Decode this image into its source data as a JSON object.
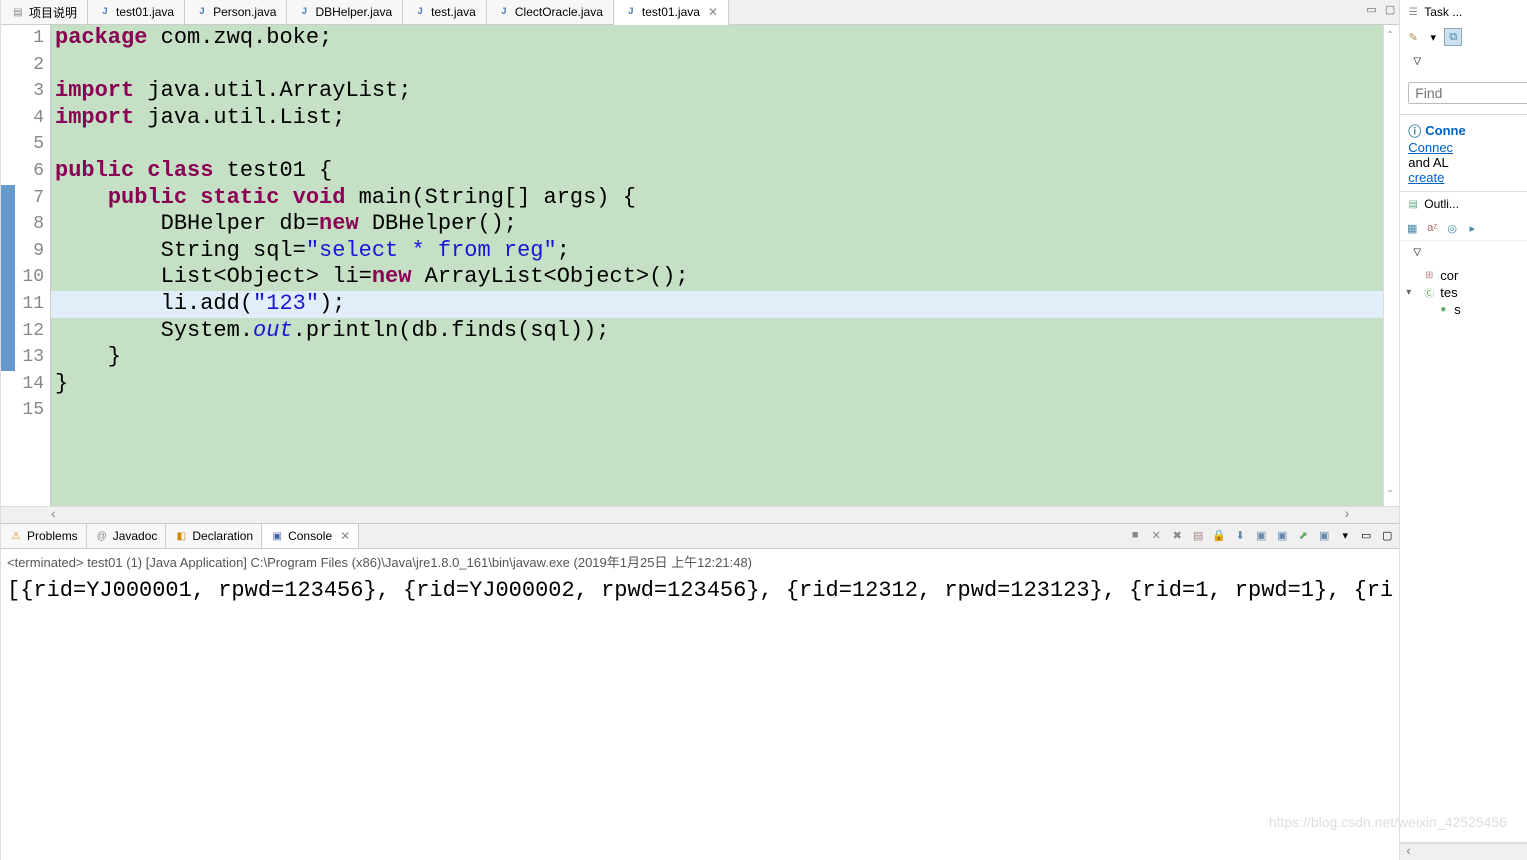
{
  "tabs": [
    {
      "label": "项目说明",
      "icon": "doc"
    },
    {
      "label": "test01.java",
      "icon": "java"
    },
    {
      "label": "Person.java",
      "icon": "java"
    },
    {
      "label": "DBHelper.java",
      "icon": "java"
    },
    {
      "label": "test.java",
      "icon": "java"
    },
    {
      "label": "ClectOracle.java",
      "icon": "java"
    },
    {
      "label": "test01.java",
      "icon": "java",
      "active": true,
      "closable": true
    }
  ],
  "code": {
    "lines": [
      {
        "n": 1,
        "html": "<span class='kw'>package</span> com.zwq.boke;"
      },
      {
        "n": 2,
        "html": ""
      },
      {
        "n": 3,
        "html": "<span class='kw'>import</span> java.util.ArrayList;"
      },
      {
        "n": 4,
        "html": "<span class='kw'>import</span> java.util.List;"
      },
      {
        "n": 5,
        "html": ""
      },
      {
        "n": 6,
        "html": "<span class='kw'>public</span> <span class='kw'>class</span> test01 {"
      },
      {
        "n": 7,
        "html": "    <span class='kw'>public</span> <span class='kw'>static</span> <span class='kw'>void</span> main(String[] args) {",
        "marker": true
      },
      {
        "n": 8,
        "html": "        DBHelper db=<span class='kw'>new</span> DBHelper();",
        "marker": true
      },
      {
        "n": 9,
        "html": "        String sql=<span class='str'>\"select * from reg\"</span>;",
        "marker": true
      },
      {
        "n": 10,
        "html": "        List&lt;Object&gt; li=<span class='kw'>new</span> ArrayList&lt;Object&gt;();",
        "marker": true
      },
      {
        "n": 11,
        "html": "        li.add(<span class='str'>\"123\"</span>);",
        "marker": true,
        "highlight": true
      },
      {
        "n": 12,
        "html": "        System.<span class='field-italic'>out</span>.println(db.finds(sql));",
        "marker": true
      },
      {
        "n": 13,
        "html": "    }",
        "marker": true
      },
      {
        "n": 14,
        "html": "}"
      },
      {
        "n": 15,
        "html": ""
      }
    ]
  },
  "bottomTabs": {
    "problems": "Problems",
    "javadoc": "Javadoc",
    "declaration": "Declaration",
    "console": "Console"
  },
  "console": {
    "info": "<terminated> test01 (1) [Java Application] C:\\Program Files (x86)\\Java\\jre1.8.0_161\\bin\\javaw.exe (2019年1月25日 上午12:21:48)",
    "output": "[{rid=YJ000001, rpwd=123456}, {rid=YJ000002, rpwd=123456}, {rid=12312, rpwd=123123}, {rid=1, rpwd=1}, {ri"
  },
  "rightPanel": {
    "task": "Task ...",
    "find": "Find",
    "connector": {
      "title": "Conne",
      "link1": "Connec",
      "text": "and AL",
      "link2": "create"
    },
    "outline": {
      "title": "Outli...",
      "items": [
        {
          "label": "cor",
          "icon": "package"
        },
        {
          "label": "tes",
          "icon": "class",
          "expanded": true,
          "children": [
            {
              "label": "s",
              "icon": "method"
            }
          ]
        }
      ]
    }
  },
  "watermark": "https://blog.csdn.net/weixin_42525456"
}
